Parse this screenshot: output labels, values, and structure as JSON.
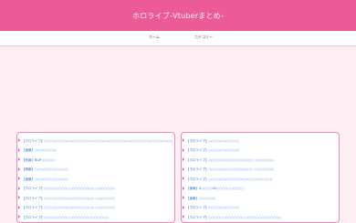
{
  "header": {
    "site_title": "ホロライブ-Vtuberまとめ-"
  },
  "nav": {
    "items": [
      "ホーム",
      "カテゴリー"
    ]
  },
  "lists": {
    "left": [
      "【ホロライブ】○○○○○○○○○○○○○○○○○○○○○○○○○○○○○○○○○○○○○○○○○○○○○○",
      "【速報】○○○○○○○○",
      "【悲報】BGP○○○○○",
      "【朗報】○○○○○○○○○○○○",
      "【速報】○○○○○○○○○○○○",
      "【ホロライブ】○○○○○○○○○○○○○○○○○○ ○○○○○○○",
      "【ホロライブ】○○○○○○○○○○○○○○○○○○ ○○○○○○○",
      "【ホロライブ】○○○○○○○○○○○○○○○○○○ ○○○○○○○",
      "【ホロライブ】○○○○○○○○○○○○○○○○○○○○○○○"
    ],
    "right": [
      "【ホロライブ】○○○○○○○○○○○",
      "【ホロライブ】○○○○○○○○○○○",
      "【ホロライブ】○○○○○○○○○○○○○○○○ ○○○○○○○",
      "【ホロライブ】○○○○○○○○○○○○○○○○ ○○○○○○○",
      "【ホロライブ】○○○○○○○○○○○○○○○○○○○○○○○",
      "【速報】3○○○○SS○○○○○○○○○○",
      "【速報】○○○○○○",
      "【ホロライブ】○○○○○○○○○○○",
      "【ホロライブ】○○○○○○○○○○○○○○○○○○○○○○○○○○"
    ]
  },
  "colors": {
    "accent": "#ec5b95",
    "link": "#2a6fd6",
    "background": "#fdeef4"
  }
}
